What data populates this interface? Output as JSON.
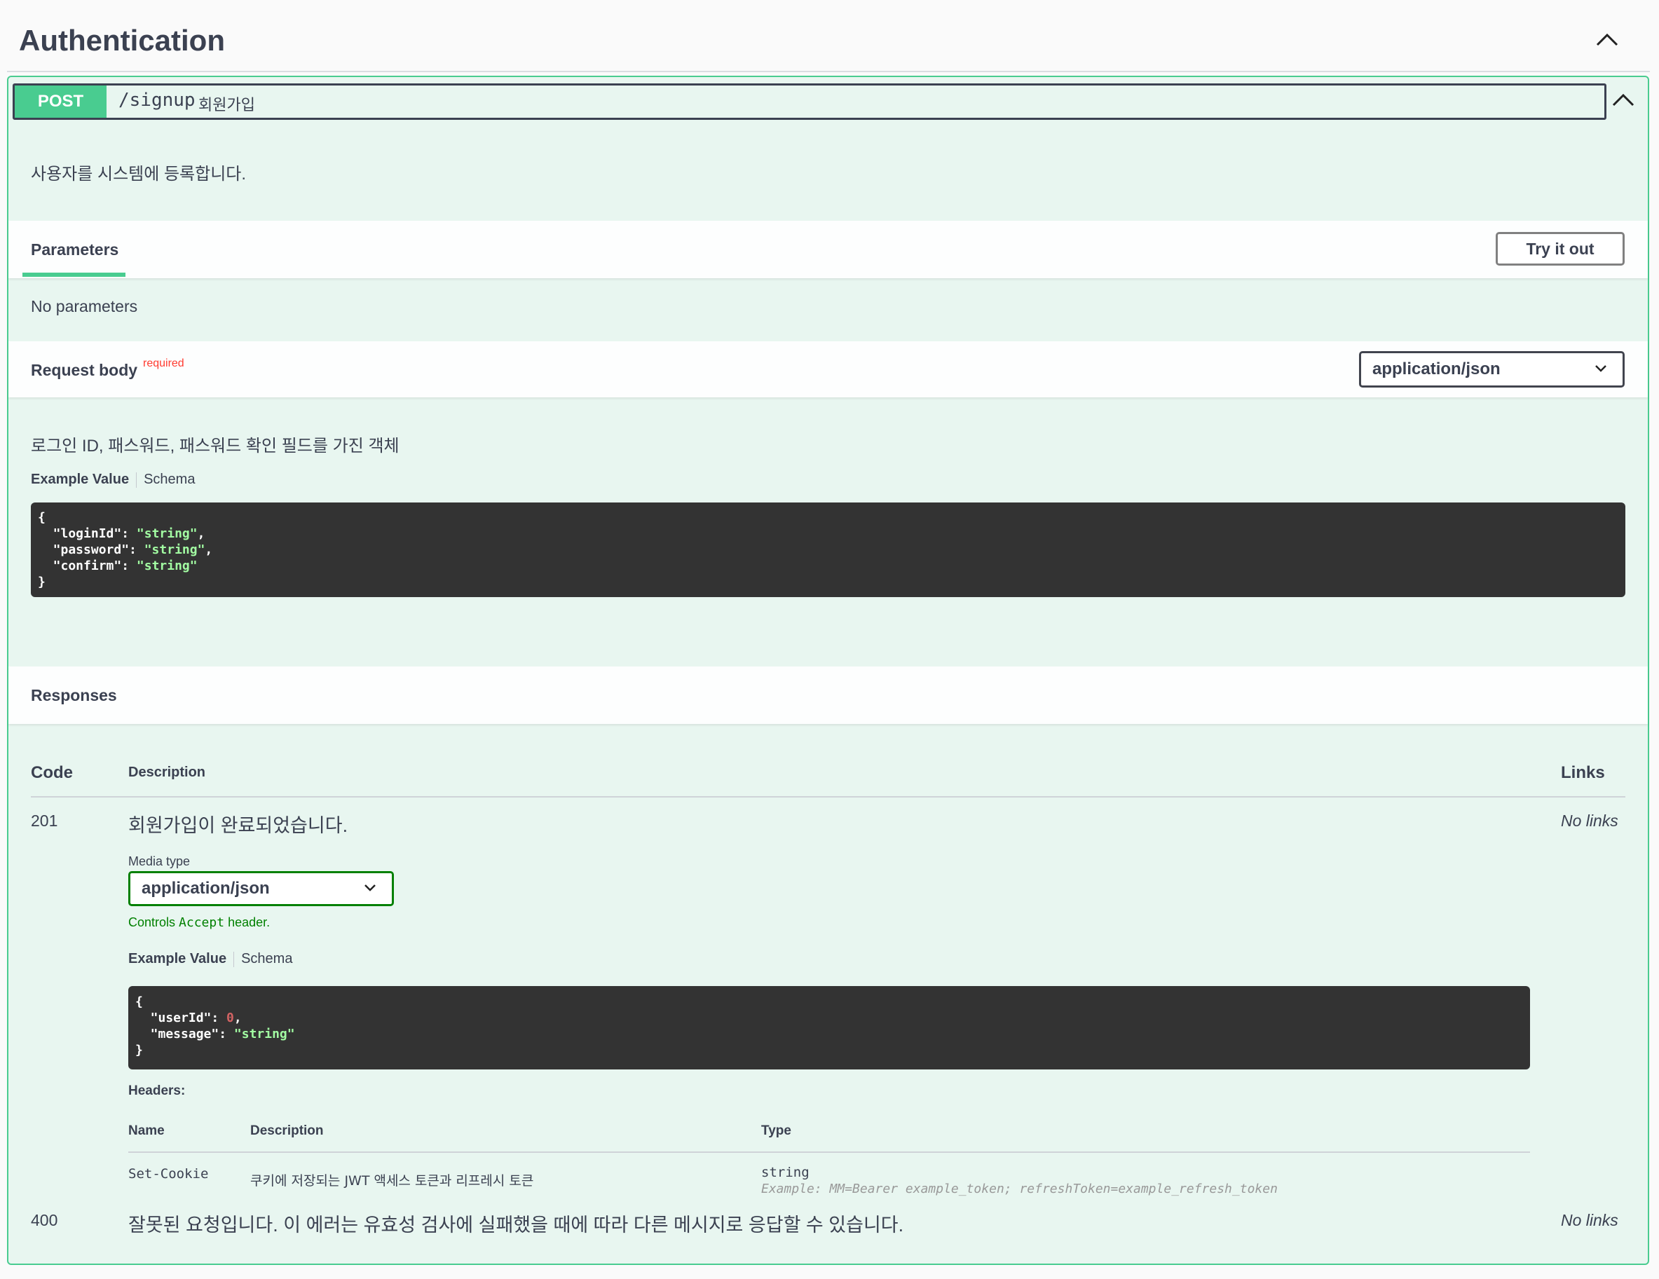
{
  "section": {
    "title": "Authentication"
  },
  "operation": {
    "method": "POST",
    "path": "/signup",
    "summary": "회원가입",
    "description": "사용자를 시스템에 등록합니다."
  },
  "parameters": {
    "tab_label": "Parameters",
    "try_label": "Try it out",
    "empty_text": "No parameters"
  },
  "request_body": {
    "title": "Request body",
    "required_label": "required",
    "content_type": "application/json",
    "description": "로그인 ID, 패스워드, 패스워드 확인 필드를 가진 객체",
    "tabs": {
      "example": "Example Value",
      "schema": "Schema"
    },
    "example_lines": {
      "open": "{",
      "l1": {
        "key": "  \"loginId\": ",
        "val": "\"string\"",
        "tail": ","
      },
      "l2": {
        "key": "  \"password\": ",
        "val": "\"string\"",
        "tail": ","
      },
      "l3": {
        "key": "  \"confirm\": ",
        "val": "\"string\"",
        "tail": ""
      },
      "close": "}"
    }
  },
  "responses": {
    "title": "Responses",
    "columns": {
      "code": "Code",
      "description": "Description",
      "links": "Links"
    },
    "rows": [
      {
        "code": "201",
        "description": "회원가입이 완료되었습니다.",
        "links": "No links",
        "media_type_label": "Media type",
        "media_type": "application/json",
        "controls_prefix": "Controls ",
        "controls_mono": "Accept",
        "controls_suffix": " header.",
        "tabs": {
          "example": "Example Value",
          "schema": "Schema"
        },
        "example_lines": {
          "open": "{",
          "l1": {
            "key": "  \"userId\": ",
            "val": "0",
            "tail": ","
          },
          "l2": {
            "key": "  \"message\": ",
            "val": "\"string\"",
            "tail": ""
          },
          "close": "}"
        },
        "headers": {
          "title": "Headers:",
          "columns": {
            "name": "Name",
            "description": "Description",
            "type": "Type"
          },
          "rows": [
            {
              "name": "Set-Cookie",
              "description": "쿠키에 저장되는 JWT 액세스 토큰과 리프레시 토큰",
              "type": "string",
              "example": "Example: MM=Bearer example_token; refreshToken=example_refresh_token"
            }
          ]
        }
      },
      {
        "code": "400",
        "description": "잘못된 요청입니다. 이 에러는 유효성 검사에 실패했을 때에 따라 다른 메시지로 응답할 수 있습니다.",
        "links": "No links"
      }
    ]
  },
  "colors": {
    "post_accent": "#49cc90",
    "post_bg": "#e8f6f0",
    "code_bg": "#333333",
    "string_literal": "#a2fca2",
    "number_literal": "#d36363",
    "required": "#ff3b30",
    "controls_note": "#008000"
  },
  "icons": {
    "collapse": "chevron-up-icon",
    "dropdown": "chevron-down-icon"
  }
}
